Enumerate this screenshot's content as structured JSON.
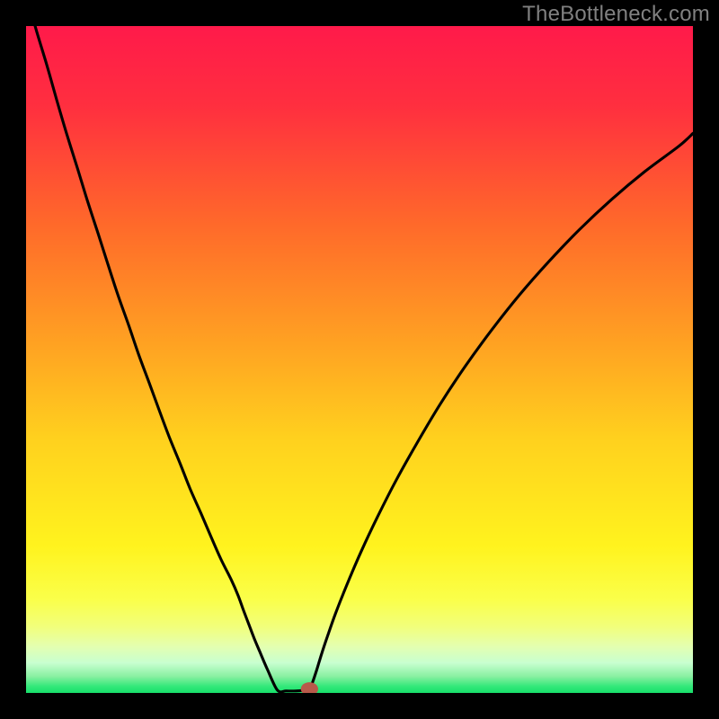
{
  "watermark": "TheBottleneck.com",
  "chart_data": {
    "type": "line",
    "title": "",
    "xlabel": "",
    "ylabel": "",
    "xlim": [
      0,
      100
    ],
    "ylim": [
      0,
      100
    ],
    "gradient_stops": [
      {
        "offset": 0.0,
        "color": "#ff1a4a"
      },
      {
        "offset": 0.12,
        "color": "#ff2f3f"
      },
      {
        "offset": 0.3,
        "color": "#ff6a2a"
      },
      {
        "offset": 0.48,
        "color": "#ffa322"
      },
      {
        "offset": 0.62,
        "color": "#ffd11e"
      },
      {
        "offset": 0.78,
        "color": "#fff31e"
      },
      {
        "offset": 0.86,
        "color": "#faff4a"
      },
      {
        "offset": 0.9,
        "color": "#f2ff7a"
      },
      {
        "offset": 0.93,
        "color": "#e4ffb0"
      },
      {
        "offset": 0.955,
        "color": "#c8ffd0"
      },
      {
        "offset": 0.975,
        "color": "#8af0a2"
      },
      {
        "offset": 0.99,
        "color": "#34e87a"
      },
      {
        "offset": 1.0,
        "color": "#17e06a"
      }
    ],
    "series": [
      {
        "name": "left-curve",
        "x": [
          0.0,
          1.5,
          3.1,
          4.6,
          6.1,
          7.7,
          9.2,
          10.8,
          12.3,
          13.8,
          15.4,
          16.9,
          18.5,
          20.0,
          21.5,
          23.1,
          24.6,
          26.2,
          27.7,
          29.2,
          30.8,
          31.8,
          32.6,
          33.4,
          34.2,
          35.0,
          36.2,
          37.7
        ],
        "y": [
          105.0,
          99.5,
          94.2,
          88.9,
          83.8,
          78.7,
          73.8,
          68.9,
          64.2,
          59.6,
          55.1,
          50.7,
          46.4,
          42.3,
          38.3,
          34.4,
          30.6,
          27.0,
          23.5,
          20.1,
          16.9,
          14.6,
          12.4,
          10.3,
          8.2,
          6.3,
          3.5,
          0.4
        ]
      },
      {
        "name": "valley-flat",
        "x": [
          37.7,
          39.0,
          40.5,
          41.8,
          42.5
        ],
        "y": [
          0.4,
          0.3,
          0.3,
          0.4,
          0.5
        ]
      },
      {
        "name": "right-curve",
        "x": [
          42.5,
          43.0,
          43.6,
          44.3,
          45.2,
          46.4,
          48.1,
          50.2,
          52.7,
          55.5,
          58.7,
          62.1,
          65.8,
          69.8,
          74.0,
          78.4,
          83.0,
          87.8,
          92.8,
          97.9,
          100.0
        ],
        "y": [
          0.5,
          1.7,
          3.5,
          5.8,
          8.5,
          11.9,
          16.2,
          21.1,
          26.4,
          31.9,
          37.6,
          43.3,
          48.9,
          54.4,
          59.7,
          64.7,
          69.5,
          74.0,
          78.2,
          82.0,
          83.9
        ]
      }
    ],
    "marker": {
      "x": 42.5,
      "y": 0.6,
      "rx": 1.3,
      "ry": 1.0,
      "color": "#b85a4a"
    }
  }
}
